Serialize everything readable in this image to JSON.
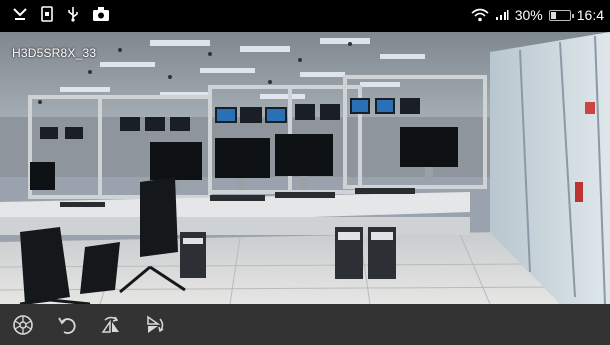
{
  "status_bar": {
    "left_icons": [
      "missed-call-icon",
      "portrait-lock-icon",
      "usb-icon",
      "camera-icon"
    ],
    "signal_text": "30%",
    "battery_level": 0.3,
    "clock": "16:4",
    "right_icons": [
      "wifi-icon",
      "cell-signal-icon",
      "battery-icon"
    ]
  },
  "video": {
    "camera_label": "H3D5SR8X_33",
    "scene": "data-center-office-surveillance-view"
  },
  "controls": {
    "items": [
      "fisheye-icon",
      "rotate-icon",
      "flip-horizontal-icon",
      "flip-vertical-icon"
    ]
  },
  "colors": {
    "status_bar_bg": "#000000",
    "controls_bg": "#333333",
    "icon_color": "#d9d9d9"
  }
}
